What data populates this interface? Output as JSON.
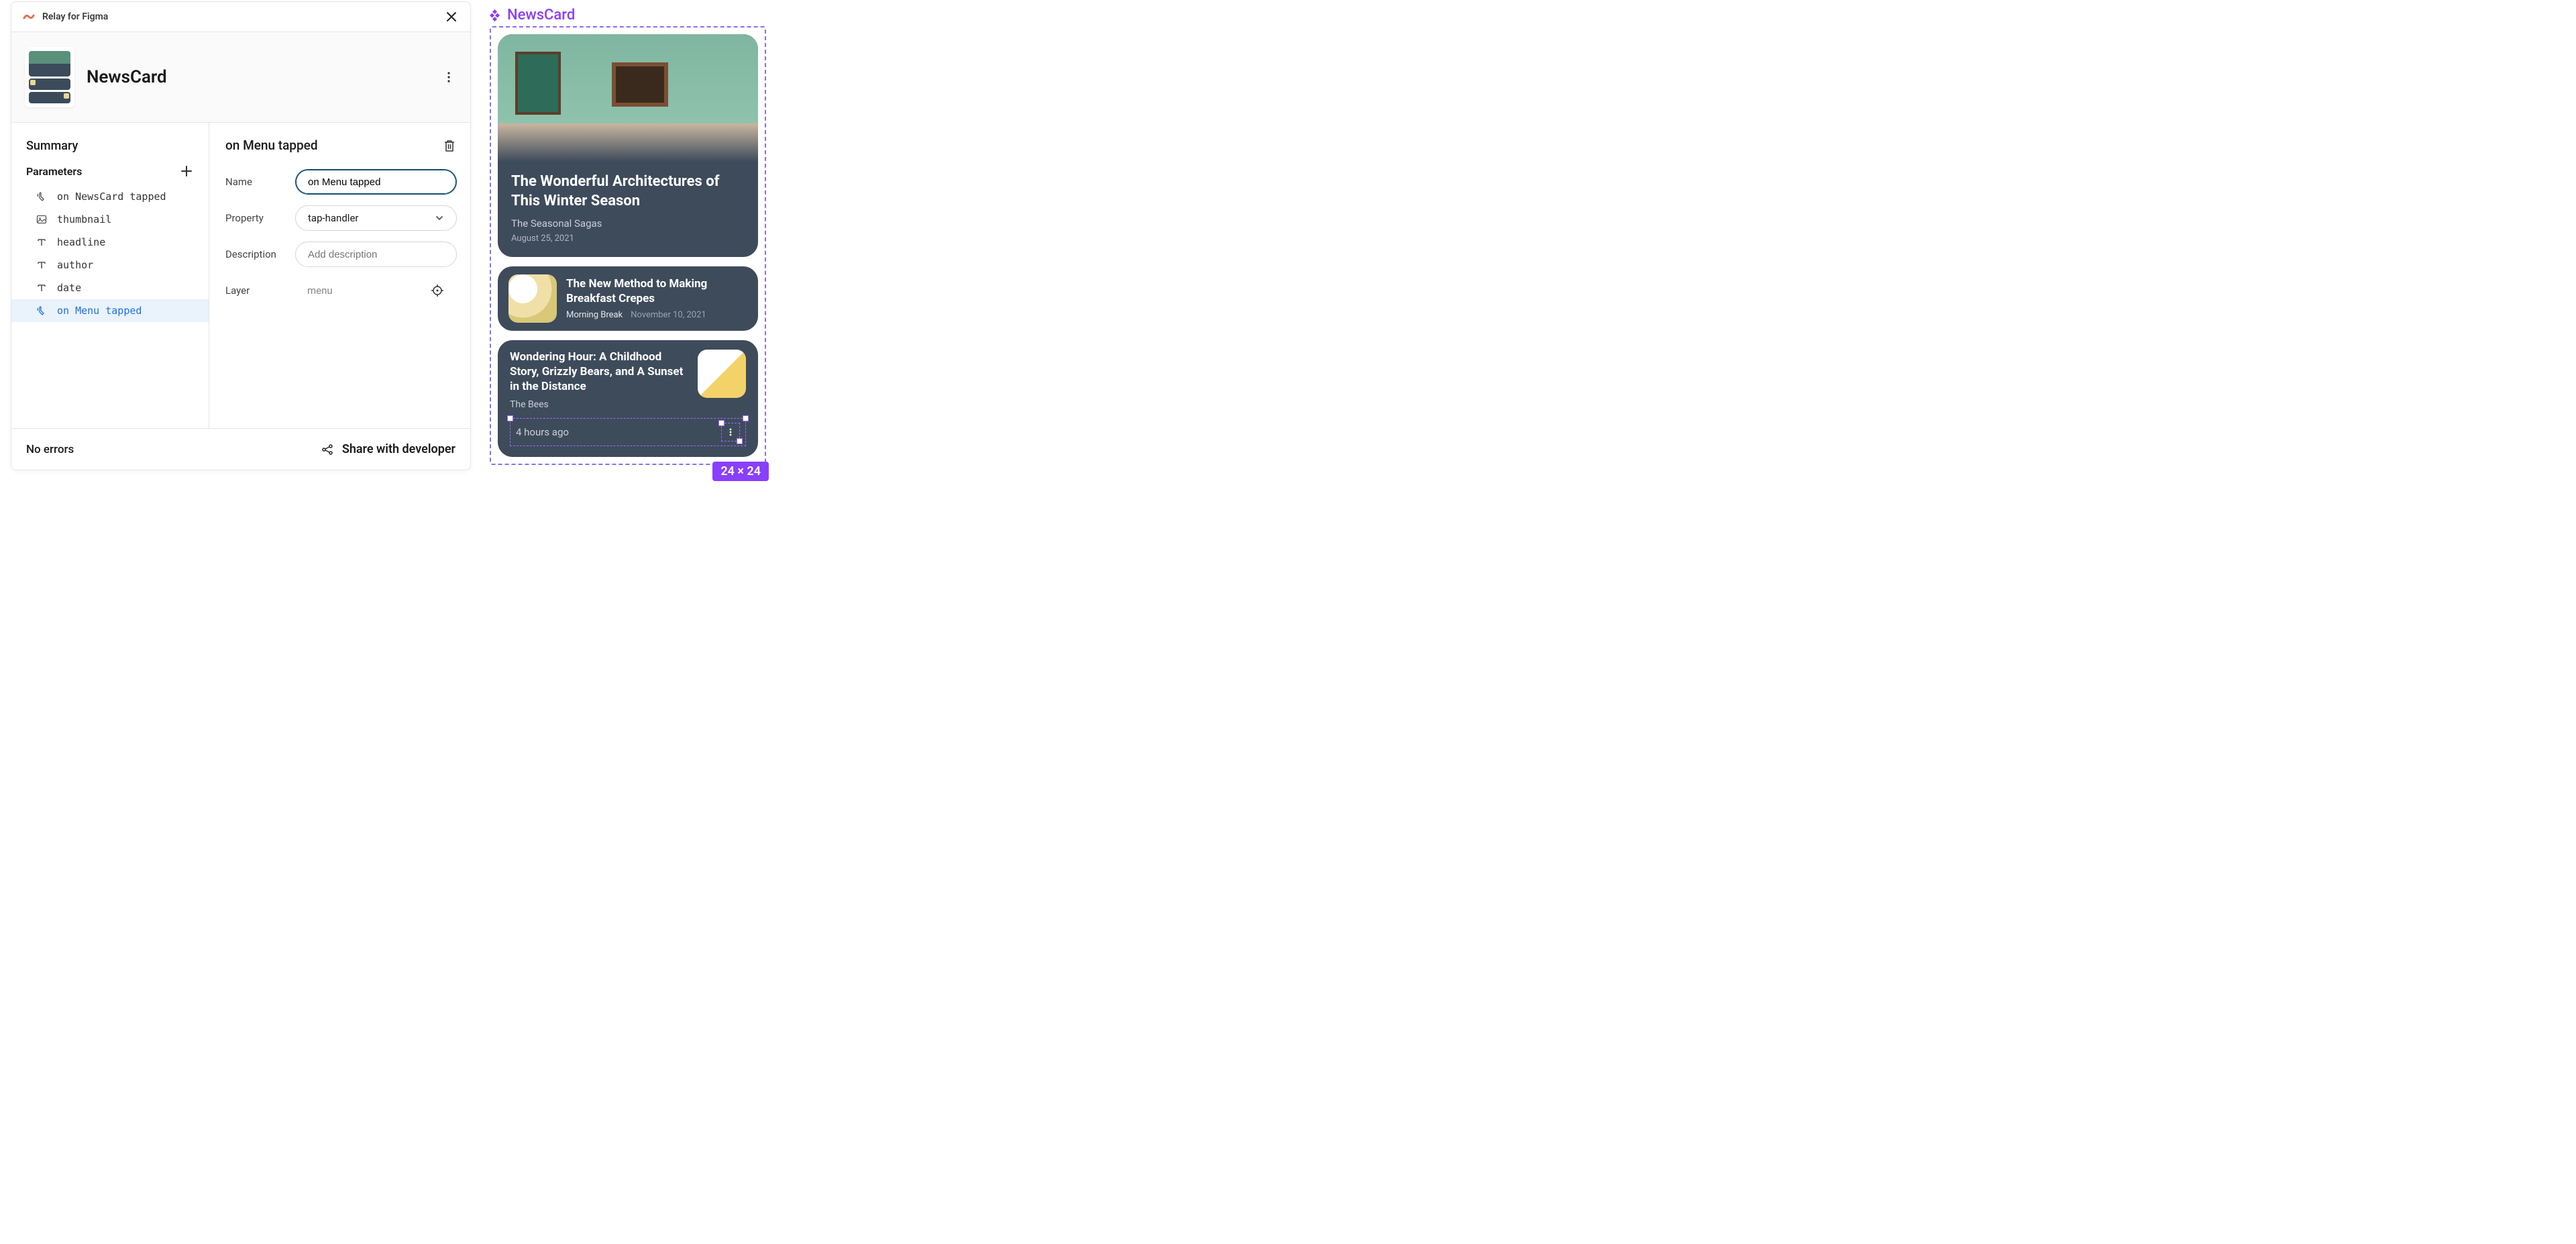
{
  "panel": {
    "title": "Relay for Figma",
    "component_name": "NewsCard",
    "summary_label": "Summary",
    "parameters_label": "Parameters",
    "parameters": [
      {
        "icon": "tap",
        "label": "on NewsCard tapped"
      },
      {
        "icon": "image",
        "label": "thumbnail"
      },
      {
        "icon": "text",
        "label": "headline"
      },
      {
        "icon": "text",
        "label": "author"
      },
      {
        "icon": "text",
        "label": "date"
      },
      {
        "icon": "tap",
        "label": "on Menu tapped"
      }
    ],
    "selected_param_index": 5,
    "detail": {
      "title": "on Menu tapped",
      "fields": {
        "name_label": "Name",
        "name_value": "on Menu tapped",
        "property_label": "Property",
        "property_value": "tap-handler",
        "description_label": "Description",
        "description_placeholder": "Add description",
        "layer_label": "Layer",
        "layer_value": "menu"
      }
    },
    "footer": {
      "status": "No errors",
      "share": "Share with developer"
    }
  },
  "canvas": {
    "frame_label": "NewsCard",
    "dims_badge": "24 × 24",
    "cards": {
      "hero": {
        "title": "The Wonderful Architectures of This Winter Season",
        "author": "The Seasonal Sagas",
        "date": "August 25, 2021"
      },
      "small": {
        "title": "The New Method to Making Breakfast Crepes",
        "author": "Morning Break",
        "date": "November 10, 2021"
      },
      "third": {
        "title": "Wondering Hour: A Childhood Story, Grizzly Bears, and A Sunset in the Distance",
        "author": "The Bees",
        "time": "4 hours ago"
      }
    }
  }
}
